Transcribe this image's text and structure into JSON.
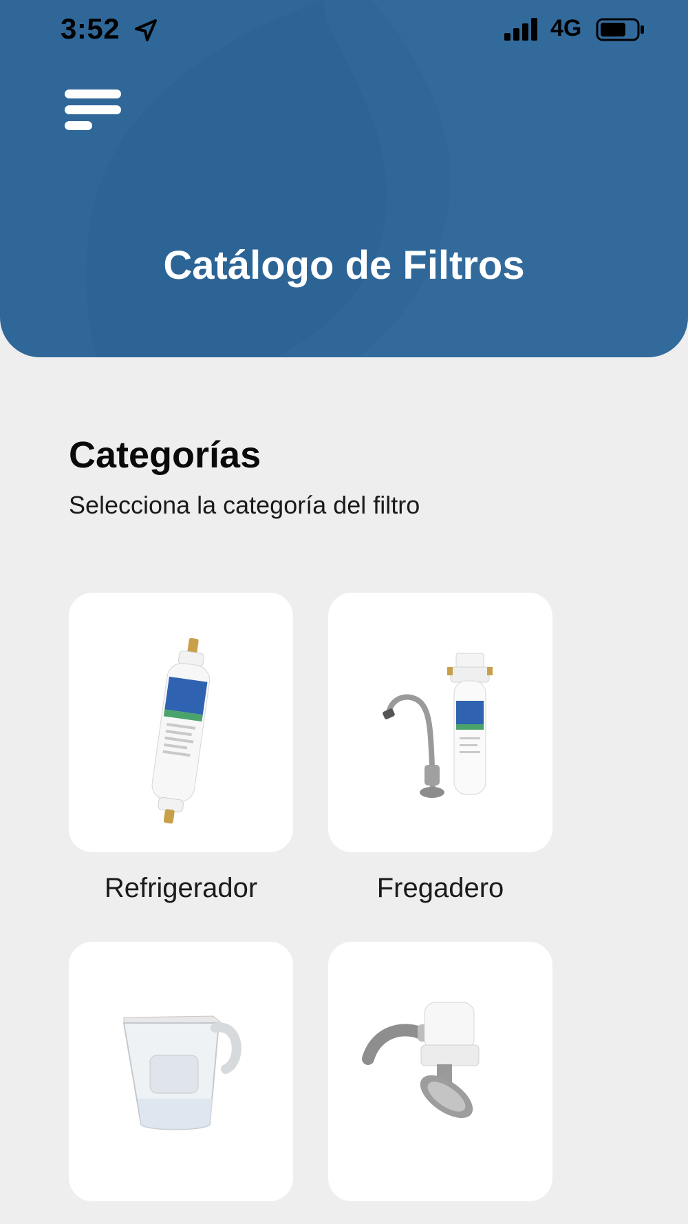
{
  "status_bar": {
    "time": "3:52",
    "network": "4G",
    "location_icon": "location-arrow-icon",
    "signal_icon": "signal-bars-icon",
    "battery_icon": "battery-icon"
  },
  "header": {
    "menu_icon": "hamburger-menu-icon",
    "title": "Catálogo de Filtros",
    "background_color": "#2f6799"
  },
  "section": {
    "title": "Categorías",
    "subtitle": "Selecciona la categoría del filtro"
  },
  "categories": [
    {
      "label": "Refrigerador",
      "image": "inline-refrigerator-filter"
    },
    {
      "label": "Fregadero",
      "image": "sink-filter-with-faucet"
    },
    {
      "label": "",
      "image": "water-pitcher-filter"
    },
    {
      "label": "",
      "image": "faucet-mount-filter"
    }
  ]
}
